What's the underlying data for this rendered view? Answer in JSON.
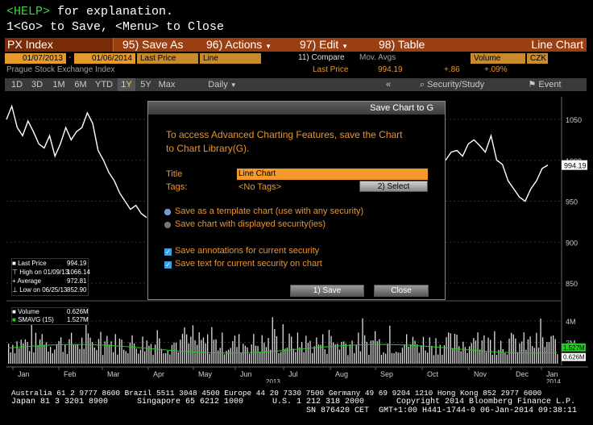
{
  "help": {
    "key": "<HELP>",
    "rest": " for explanation."
  },
  "go": "1<Go> to Save, <Menu> to Close",
  "cmdbar": {
    "index": "PX Index",
    "save_as": "95) Save As",
    "actions": "96) Actions",
    "edit": "97) Edit",
    "table": "98) Table",
    "chart_type": "Line Chart"
  },
  "params": {
    "start_date": "01/07/2013",
    "end_date": "01/06/2014",
    "field": "Last Price",
    "style": "Line",
    "compare": "11) Compare",
    "mov_avgs": "Mov. Avgs",
    "volume": "Volume",
    "currency": "CZK"
  },
  "quote": {
    "name": "Prague Stock Exchange Index",
    "label": "Last Price",
    "price": "994.19",
    "change": "+.86",
    "pct": "+.09%"
  },
  "timeframes": [
    "1D",
    "3D",
    "1M",
    "6M",
    "YTD",
    "1Y",
    "5Y",
    "Max"
  ],
  "active_timeframe": "1Y",
  "period": "Daily",
  "security_study": "Security/Study",
  "event": "Event",
  "legend_price": {
    "rows": [
      {
        "label": "Last Price",
        "value": "994.19"
      },
      {
        "label": "High on 01/09/13",
        "value": "1066.14"
      },
      {
        "label": "Average",
        "value": "972.81"
      },
      {
        "label": "Low on 06/25/13",
        "value": "852.90"
      }
    ]
  },
  "legend_volume": {
    "rows": [
      {
        "label": "Volume",
        "value": "0.626M"
      },
      {
        "label": "SMAVG (15)",
        "value": "1.527M"
      }
    ]
  },
  "chart_data": {
    "type": "line",
    "price_axis": [
      "1050",
      "1000",
      "950",
      "900",
      "850"
    ],
    "price_last_tag": "994.19",
    "volume_axis": [
      "4M",
      "2M"
    ],
    "volume_tags": [
      "1.527M",
      "0.626M"
    ],
    "months": [
      "Jan",
      "Feb",
      "Mar",
      "Apr",
      "May",
      "Jun",
      "Jul",
      "Aug",
      "Sep",
      "Oct",
      "Nov",
      "Dec",
      "Jan"
    ],
    "year_labels": [
      "2013",
      "2014"
    ],
    "series": [
      {
        "name": "Last Price",
        "values": [
          1050,
          1066,
          1040,
          1030,
          1048,
          1035,
          1020,
          1015,
          1030,
          1005,
          1020,
          1040,
          1025,
          1035,
          1040,
          1058,
          1045,
          1012,
          1000,
          985,
          975,
          960,
          950,
          940,
          945,
          935,
          930
        ]
      },
      {
        "name": "Last Price (Sep–Dec)",
        "values": [
          1000,
          1010,
          1012,
          1005,
          1020,
          1025,
          1018,
          1010,
          1030,
          1000,
          995,
          975,
          965,
          955,
          950,
          965,
          975,
          990,
          994.19
        ]
      }
    ]
  },
  "dialog": {
    "title": "Save Chart to G",
    "intro1": "To access Advanced Charting Features, save the Chart",
    "intro2": "to Chart Library(G).",
    "title_label": "Title",
    "title_value": "Line Chart",
    "tags_label": "Tags:",
    "tags_value": "<No Tags>",
    "select_btn": "2) Select",
    "opt_template": "Save as a template chart (use with any security)",
    "opt_displayed": "Save chart with displayed security(ies)",
    "chk_annotations": "Save annotations for current security",
    "chk_text": "Save text for current security on chart",
    "save_btn": "1) Save",
    "close_btn": "Close"
  },
  "footer": {
    "line1": "Australia 61 2 9777 8600 Brazil 5511 3048 4500 Europe 44 20 7330 7500 Germany 49 69 9204 1210 Hong Kong 852 2977 6000",
    "line2a": "Japan 81 3 3201 8900",
    "line2b": "Singapore 65 6212 1000",
    "line2c": "U.S. 1 212 318 2000",
    "line2d": "Copyright 2014 Bloomberg Finance L.P.",
    "line3": "SN 876420 CET  GMT+1:00 H441-1744-0 06-Jan-2014 09:38:11"
  },
  "colors": {
    "accent": "#e8962e",
    "bar": "#9a3f12",
    "volume": "#ffffff",
    "sma": "#22cc22"
  }
}
